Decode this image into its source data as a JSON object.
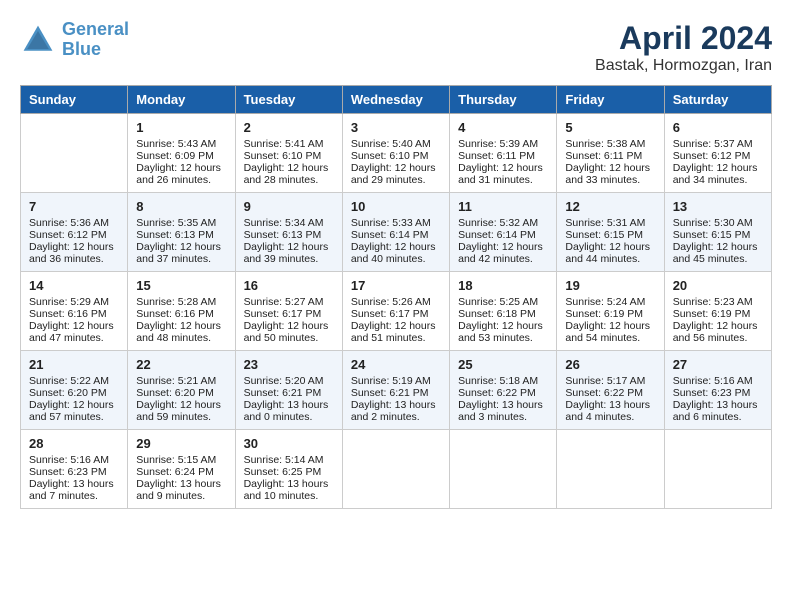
{
  "header": {
    "logo_line1": "General",
    "logo_line2": "Blue",
    "month_title": "April 2024",
    "subtitle": "Bastak, Hormozgan, Iran"
  },
  "weekdays": [
    "Sunday",
    "Monday",
    "Tuesday",
    "Wednesday",
    "Thursday",
    "Friday",
    "Saturday"
  ],
  "weeks": [
    [
      {
        "day": "",
        "sunrise": "",
        "sunset": "",
        "daylight": ""
      },
      {
        "day": "1",
        "sunrise": "Sunrise: 5:43 AM",
        "sunset": "Sunset: 6:09 PM",
        "daylight": "Daylight: 12 hours and 26 minutes."
      },
      {
        "day": "2",
        "sunrise": "Sunrise: 5:41 AM",
        "sunset": "Sunset: 6:10 PM",
        "daylight": "Daylight: 12 hours and 28 minutes."
      },
      {
        "day": "3",
        "sunrise": "Sunrise: 5:40 AM",
        "sunset": "Sunset: 6:10 PM",
        "daylight": "Daylight: 12 hours and 29 minutes."
      },
      {
        "day": "4",
        "sunrise": "Sunrise: 5:39 AM",
        "sunset": "Sunset: 6:11 PM",
        "daylight": "Daylight: 12 hours and 31 minutes."
      },
      {
        "day": "5",
        "sunrise": "Sunrise: 5:38 AM",
        "sunset": "Sunset: 6:11 PM",
        "daylight": "Daylight: 12 hours and 33 minutes."
      },
      {
        "day": "6",
        "sunrise": "Sunrise: 5:37 AM",
        "sunset": "Sunset: 6:12 PM",
        "daylight": "Daylight: 12 hours and 34 minutes."
      }
    ],
    [
      {
        "day": "7",
        "sunrise": "Sunrise: 5:36 AM",
        "sunset": "Sunset: 6:12 PM",
        "daylight": "Daylight: 12 hours and 36 minutes."
      },
      {
        "day": "8",
        "sunrise": "Sunrise: 5:35 AM",
        "sunset": "Sunset: 6:13 PM",
        "daylight": "Daylight: 12 hours and 37 minutes."
      },
      {
        "day": "9",
        "sunrise": "Sunrise: 5:34 AM",
        "sunset": "Sunset: 6:13 PM",
        "daylight": "Daylight: 12 hours and 39 minutes."
      },
      {
        "day": "10",
        "sunrise": "Sunrise: 5:33 AM",
        "sunset": "Sunset: 6:14 PM",
        "daylight": "Daylight: 12 hours and 40 minutes."
      },
      {
        "day": "11",
        "sunrise": "Sunrise: 5:32 AM",
        "sunset": "Sunset: 6:14 PM",
        "daylight": "Daylight: 12 hours and 42 minutes."
      },
      {
        "day": "12",
        "sunrise": "Sunrise: 5:31 AM",
        "sunset": "Sunset: 6:15 PM",
        "daylight": "Daylight: 12 hours and 44 minutes."
      },
      {
        "day": "13",
        "sunrise": "Sunrise: 5:30 AM",
        "sunset": "Sunset: 6:15 PM",
        "daylight": "Daylight: 12 hours and 45 minutes."
      }
    ],
    [
      {
        "day": "14",
        "sunrise": "Sunrise: 5:29 AM",
        "sunset": "Sunset: 6:16 PM",
        "daylight": "Daylight: 12 hours and 47 minutes."
      },
      {
        "day": "15",
        "sunrise": "Sunrise: 5:28 AM",
        "sunset": "Sunset: 6:16 PM",
        "daylight": "Daylight: 12 hours and 48 minutes."
      },
      {
        "day": "16",
        "sunrise": "Sunrise: 5:27 AM",
        "sunset": "Sunset: 6:17 PM",
        "daylight": "Daylight: 12 hours and 50 minutes."
      },
      {
        "day": "17",
        "sunrise": "Sunrise: 5:26 AM",
        "sunset": "Sunset: 6:17 PM",
        "daylight": "Daylight: 12 hours and 51 minutes."
      },
      {
        "day": "18",
        "sunrise": "Sunrise: 5:25 AM",
        "sunset": "Sunset: 6:18 PM",
        "daylight": "Daylight: 12 hours and 53 minutes."
      },
      {
        "day": "19",
        "sunrise": "Sunrise: 5:24 AM",
        "sunset": "Sunset: 6:19 PM",
        "daylight": "Daylight: 12 hours and 54 minutes."
      },
      {
        "day": "20",
        "sunrise": "Sunrise: 5:23 AM",
        "sunset": "Sunset: 6:19 PM",
        "daylight": "Daylight: 12 hours and 56 minutes."
      }
    ],
    [
      {
        "day": "21",
        "sunrise": "Sunrise: 5:22 AM",
        "sunset": "Sunset: 6:20 PM",
        "daylight": "Daylight: 12 hours and 57 minutes."
      },
      {
        "day": "22",
        "sunrise": "Sunrise: 5:21 AM",
        "sunset": "Sunset: 6:20 PM",
        "daylight": "Daylight: 12 hours and 59 minutes."
      },
      {
        "day": "23",
        "sunrise": "Sunrise: 5:20 AM",
        "sunset": "Sunset: 6:21 PM",
        "daylight": "Daylight: 13 hours and 0 minutes."
      },
      {
        "day": "24",
        "sunrise": "Sunrise: 5:19 AM",
        "sunset": "Sunset: 6:21 PM",
        "daylight": "Daylight: 13 hours and 2 minutes."
      },
      {
        "day": "25",
        "sunrise": "Sunrise: 5:18 AM",
        "sunset": "Sunset: 6:22 PM",
        "daylight": "Daylight: 13 hours and 3 minutes."
      },
      {
        "day": "26",
        "sunrise": "Sunrise: 5:17 AM",
        "sunset": "Sunset: 6:22 PM",
        "daylight": "Daylight: 13 hours and 4 minutes."
      },
      {
        "day": "27",
        "sunrise": "Sunrise: 5:16 AM",
        "sunset": "Sunset: 6:23 PM",
        "daylight": "Daylight: 13 hours and 6 minutes."
      }
    ],
    [
      {
        "day": "28",
        "sunrise": "Sunrise: 5:16 AM",
        "sunset": "Sunset: 6:23 PM",
        "daylight": "Daylight: 13 hours and 7 minutes."
      },
      {
        "day": "29",
        "sunrise": "Sunrise: 5:15 AM",
        "sunset": "Sunset: 6:24 PM",
        "daylight": "Daylight: 13 hours and 9 minutes."
      },
      {
        "day": "30",
        "sunrise": "Sunrise: 5:14 AM",
        "sunset": "Sunset: 6:25 PM",
        "daylight": "Daylight: 13 hours and 10 minutes."
      },
      {
        "day": "",
        "sunrise": "",
        "sunset": "",
        "daylight": ""
      },
      {
        "day": "",
        "sunrise": "",
        "sunset": "",
        "daylight": ""
      },
      {
        "day": "",
        "sunrise": "",
        "sunset": "",
        "daylight": ""
      },
      {
        "day": "",
        "sunrise": "",
        "sunset": "",
        "daylight": ""
      }
    ]
  ]
}
